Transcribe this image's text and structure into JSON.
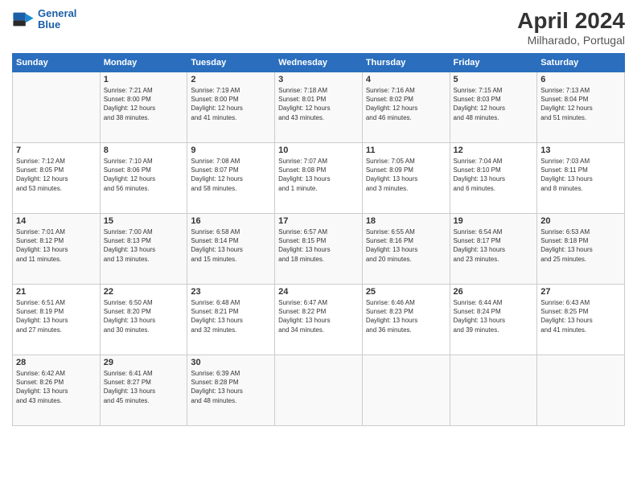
{
  "header": {
    "logo_line1": "General",
    "logo_line2": "Blue",
    "title": "April 2024",
    "location": "Milharado, Portugal"
  },
  "days_of_week": [
    "Sunday",
    "Monday",
    "Tuesday",
    "Wednesday",
    "Thursday",
    "Friday",
    "Saturday"
  ],
  "weeks": [
    [
      {
        "num": "",
        "info": ""
      },
      {
        "num": "1",
        "info": "Sunrise: 7:21 AM\nSunset: 8:00 PM\nDaylight: 12 hours\nand 38 minutes."
      },
      {
        "num": "2",
        "info": "Sunrise: 7:19 AM\nSunset: 8:00 PM\nDaylight: 12 hours\nand 41 minutes."
      },
      {
        "num": "3",
        "info": "Sunrise: 7:18 AM\nSunset: 8:01 PM\nDaylight: 12 hours\nand 43 minutes."
      },
      {
        "num": "4",
        "info": "Sunrise: 7:16 AM\nSunset: 8:02 PM\nDaylight: 12 hours\nand 46 minutes."
      },
      {
        "num": "5",
        "info": "Sunrise: 7:15 AM\nSunset: 8:03 PM\nDaylight: 12 hours\nand 48 minutes."
      },
      {
        "num": "6",
        "info": "Sunrise: 7:13 AM\nSunset: 8:04 PM\nDaylight: 12 hours\nand 51 minutes."
      }
    ],
    [
      {
        "num": "7",
        "info": "Sunrise: 7:12 AM\nSunset: 8:05 PM\nDaylight: 12 hours\nand 53 minutes."
      },
      {
        "num": "8",
        "info": "Sunrise: 7:10 AM\nSunset: 8:06 PM\nDaylight: 12 hours\nand 56 minutes."
      },
      {
        "num": "9",
        "info": "Sunrise: 7:08 AM\nSunset: 8:07 PM\nDaylight: 12 hours\nand 58 minutes."
      },
      {
        "num": "10",
        "info": "Sunrise: 7:07 AM\nSunset: 8:08 PM\nDaylight: 13 hours\nand 1 minute."
      },
      {
        "num": "11",
        "info": "Sunrise: 7:05 AM\nSunset: 8:09 PM\nDaylight: 13 hours\nand 3 minutes."
      },
      {
        "num": "12",
        "info": "Sunrise: 7:04 AM\nSunset: 8:10 PM\nDaylight: 13 hours\nand 6 minutes."
      },
      {
        "num": "13",
        "info": "Sunrise: 7:03 AM\nSunset: 8:11 PM\nDaylight: 13 hours\nand 8 minutes."
      }
    ],
    [
      {
        "num": "14",
        "info": "Sunrise: 7:01 AM\nSunset: 8:12 PM\nDaylight: 13 hours\nand 11 minutes."
      },
      {
        "num": "15",
        "info": "Sunrise: 7:00 AM\nSunset: 8:13 PM\nDaylight: 13 hours\nand 13 minutes."
      },
      {
        "num": "16",
        "info": "Sunrise: 6:58 AM\nSunset: 8:14 PM\nDaylight: 13 hours\nand 15 minutes."
      },
      {
        "num": "17",
        "info": "Sunrise: 6:57 AM\nSunset: 8:15 PM\nDaylight: 13 hours\nand 18 minutes."
      },
      {
        "num": "18",
        "info": "Sunrise: 6:55 AM\nSunset: 8:16 PM\nDaylight: 13 hours\nand 20 minutes."
      },
      {
        "num": "19",
        "info": "Sunrise: 6:54 AM\nSunset: 8:17 PM\nDaylight: 13 hours\nand 23 minutes."
      },
      {
        "num": "20",
        "info": "Sunrise: 6:53 AM\nSunset: 8:18 PM\nDaylight: 13 hours\nand 25 minutes."
      }
    ],
    [
      {
        "num": "21",
        "info": "Sunrise: 6:51 AM\nSunset: 8:19 PM\nDaylight: 13 hours\nand 27 minutes."
      },
      {
        "num": "22",
        "info": "Sunrise: 6:50 AM\nSunset: 8:20 PM\nDaylight: 13 hours\nand 30 minutes."
      },
      {
        "num": "23",
        "info": "Sunrise: 6:48 AM\nSunset: 8:21 PM\nDaylight: 13 hours\nand 32 minutes."
      },
      {
        "num": "24",
        "info": "Sunrise: 6:47 AM\nSunset: 8:22 PM\nDaylight: 13 hours\nand 34 minutes."
      },
      {
        "num": "25",
        "info": "Sunrise: 6:46 AM\nSunset: 8:23 PM\nDaylight: 13 hours\nand 36 minutes."
      },
      {
        "num": "26",
        "info": "Sunrise: 6:44 AM\nSunset: 8:24 PM\nDaylight: 13 hours\nand 39 minutes."
      },
      {
        "num": "27",
        "info": "Sunrise: 6:43 AM\nSunset: 8:25 PM\nDaylight: 13 hours\nand 41 minutes."
      }
    ],
    [
      {
        "num": "28",
        "info": "Sunrise: 6:42 AM\nSunset: 8:26 PM\nDaylight: 13 hours\nand 43 minutes."
      },
      {
        "num": "29",
        "info": "Sunrise: 6:41 AM\nSunset: 8:27 PM\nDaylight: 13 hours\nand 45 minutes."
      },
      {
        "num": "30",
        "info": "Sunrise: 6:39 AM\nSunset: 8:28 PM\nDaylight: 13 hours\nand 48 minutes."
      },
      {
        "num": "",
        "info": ""
      },
      {
        "num": "",
        "info": ""
      },
      {
        "num": "",
        "info": ""
      },
      {
        "num": "",
        "info": ""
      }
    ]
  ]
}
